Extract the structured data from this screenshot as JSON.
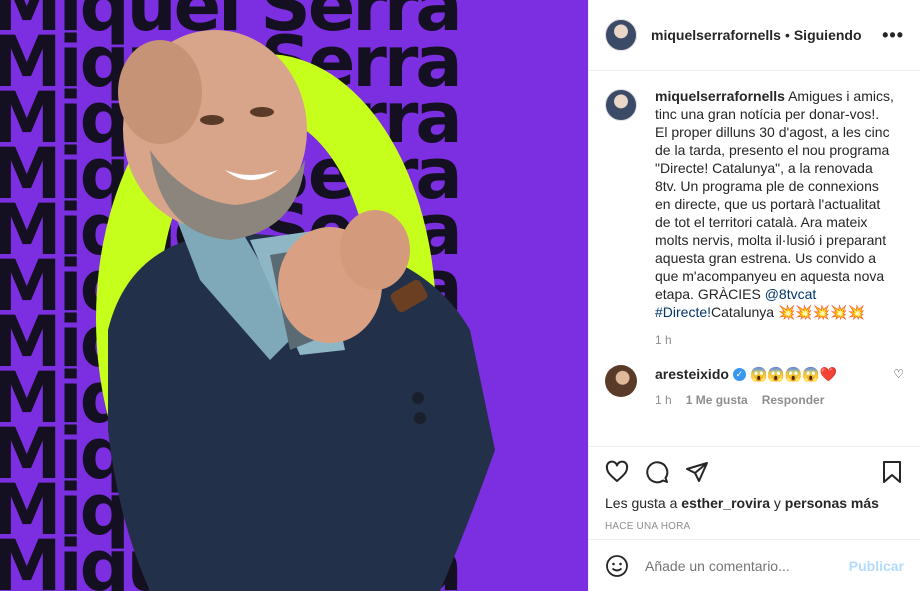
{
  "media": {
    "bg_text": "Miquel Serra",
    "bg_lines": 11,
    "colors": {
      "background": "#7c2fe0",
      "accent": "#c7ff1c",
      "text": "#141021"
    }
  },
  "header": {
    "username": "miquelserrafornells",
    "separator": "•",
    "follow_status": "Siguiendo",
    "more_icon": "ellipsis-icon"
  },
  "caption": {
    "username": "miquelserrafornells",
    "text_part1": "Amigues i amics, tinc una gran notícia per donar-vos!. El proper dilluns 30 d'agost, a les cinc de la tarda, presento el nou programa \"Directe! Catalunya\", a la renovada 8tv. Un programa ple de connexions en directe, que us portarà l'actualitat de tot el territori català. Ara mateix molts nervis, molta il·lusió i preparant aquesta gran estrena. Us convido a que m'acompanyeu en aquesta nova etapa. GRÀCIES ",
    "mention": "@8tvcat",
    "hashtag": "#Directe!",
    "text_part2": "Catalunya ",
    "emojis": "💥💥💥💥💥",
    "time": "1 h"
  },
  "comment": {
    "username": "aresteixido",
    "verified_icon": "verified-badge-icon",
    "text": "😱😱😱😱❤️",
    "time": "1 h",
    "likes": "1 Me gusta",
    "reply": "Responder"
  },
  "actions": {
    "likes_prefix": "Les gusta a",
    "liker": "esther_rovira",
    "likes_conj": "y",
    "likes_others": "personas más",
    "posted_ago": "HACE UNA HORA"
  },
  "add_comment": {
    "placeholder": "Añade un comentario...",
    "publish": "Publicar"
  }
}
